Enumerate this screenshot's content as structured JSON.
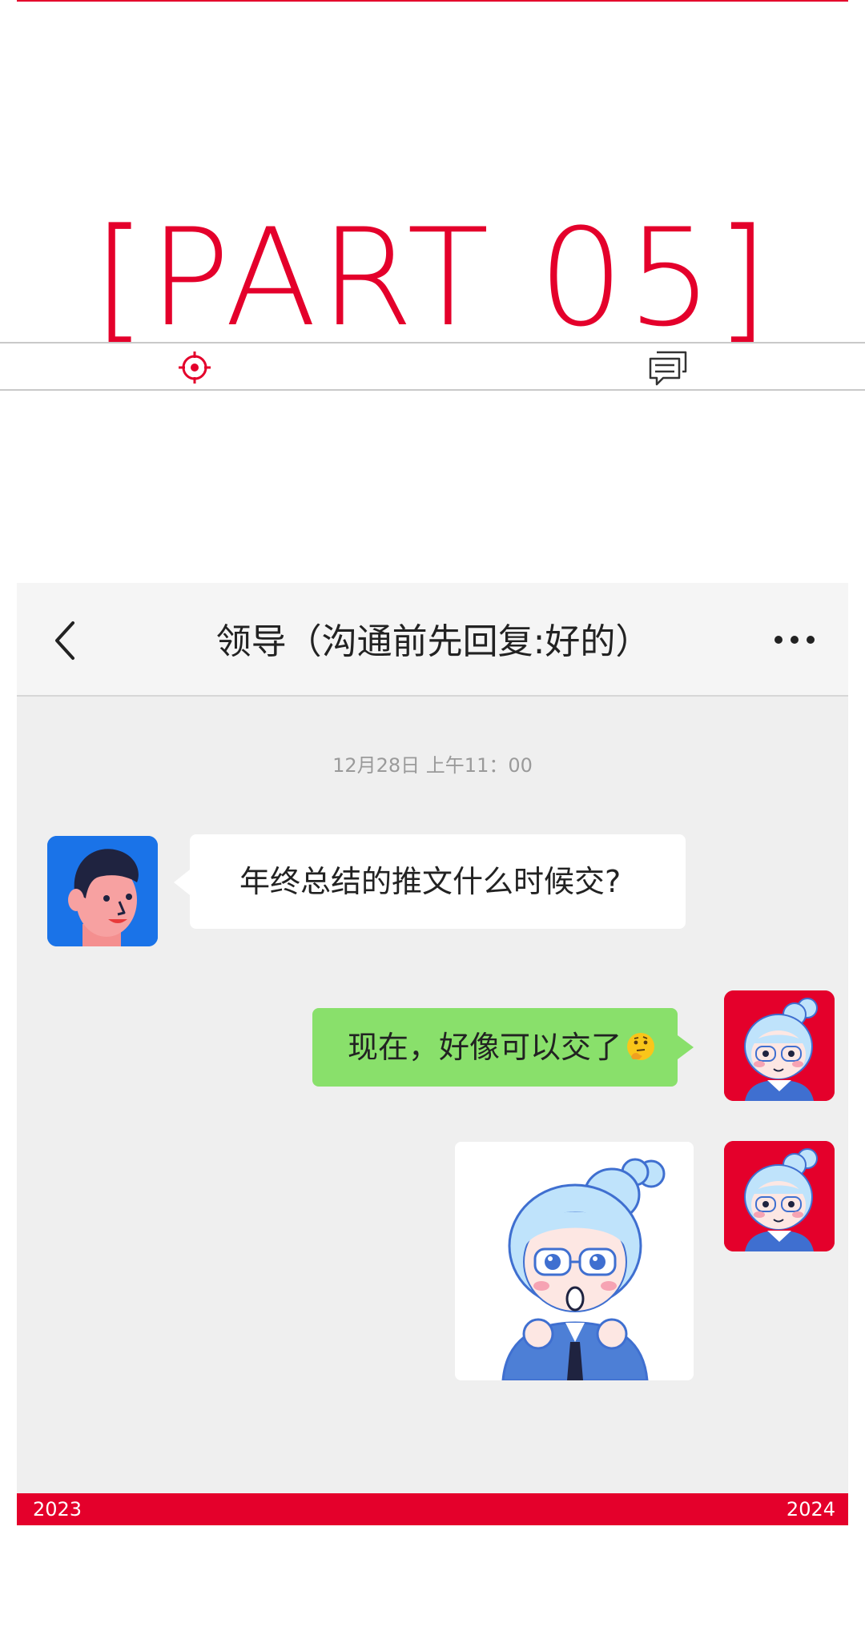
{
  "section": {
    "title": "[PART 05]",
    "accent_color": "#e4002b",
    "icons": [
      "target-icon",
      "chat-bubbles-icon"
    ]
  },
  "chat": {
    "header": {
      "title": "领导（沟通前先回复:好的）",
      "back_icon": "chevron-left-icon",
      "more_icon": "more-dots-icon"
    },
    "timestamp": "12月28日 上午11：00",
    "messages": [
      {
        "sender": "leader",
        "type": "text",
        "text": "年终总结的推文什么时候交?"
      },
      {
        "sender": "me",
        "type": "text",
        "text": "现在，好像可以交了",
        "emoji": "thinking-face-emoji"
      },
      {
        "sender": "me",
        "type": "sticker",
        "sticker": "surprised-girl-sticker"
      }
    ],
    "colors": {
      "incoming_bubble": "#ffffff",
      "outgoing_bubble": "#89e06b",
      "background": "#efefef"
    }
  },
  "footer": {
    "year_left": "2023",
    "year_right": "2024",
    "color": "#e4002b"
  }
}
